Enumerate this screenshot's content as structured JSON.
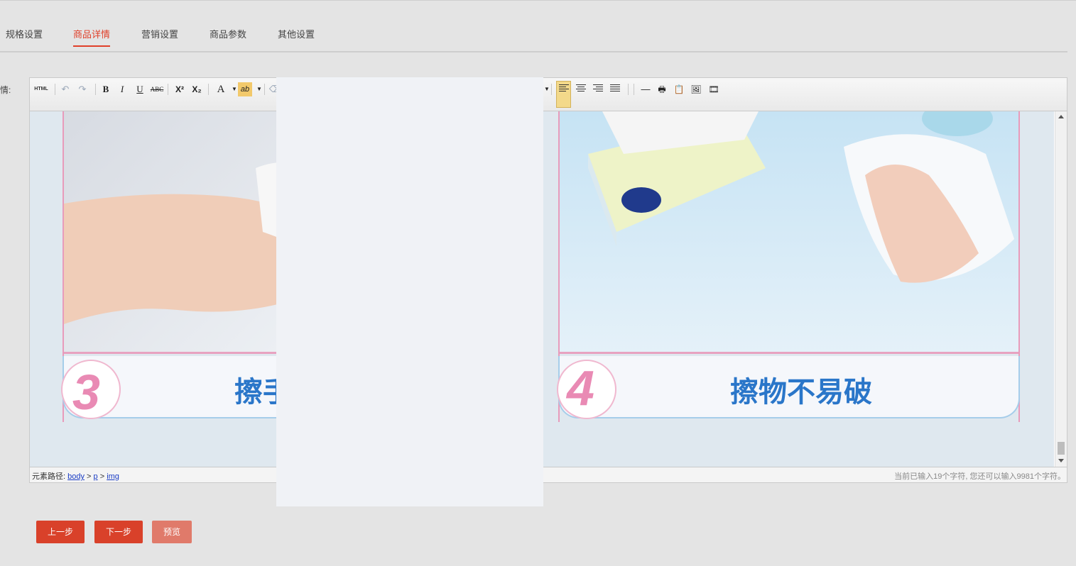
{
  "tabs": [
    {
      "label": "规格设置",
      "active": false
    },
    {
      "label": "商品详情",
      "active": true
    },
    {
      "label": "营销设置",
      "active": false
    },
    {
      "label": "商品参数",
      "active": false
    },
    {
      "label": "其他设置",
      "active": false
    }
  ],
  "field_label": "详情:",
  "toolbar": {
    "html_label": "HTML",
    "bold": "B",
    "italic": "I",
    "underline": "U",
    "strike": "ABC",
    "superscript": "X²",
    "subscript": "X₂",
    "font_color": "A",
    "highlight": "ab"
  },
  "content": {
    "panel_left": {
      "number": "3",
      "caption": "擦手"
    },
    "panel_right": {
      "number": "4",
      "caption": "擦物不易破"
    }
  },
  "statusbar": {
    "path_label": "元素路径:",
    "path": [
      "body",
      "p",
      "img"
    ],
    "counter": "当前已输入19个字符, 您还可以输入9981个字符。"
  },
  "buttons": {
    "prev": "上一步",
    "next": "下一步",
    "preview": "预览"
  },
  "colors": {
    "accent": "#e0402a",
    "caption_blue": "#2a76c9",
    "number_pink": "#e98ab4"
  }
}
